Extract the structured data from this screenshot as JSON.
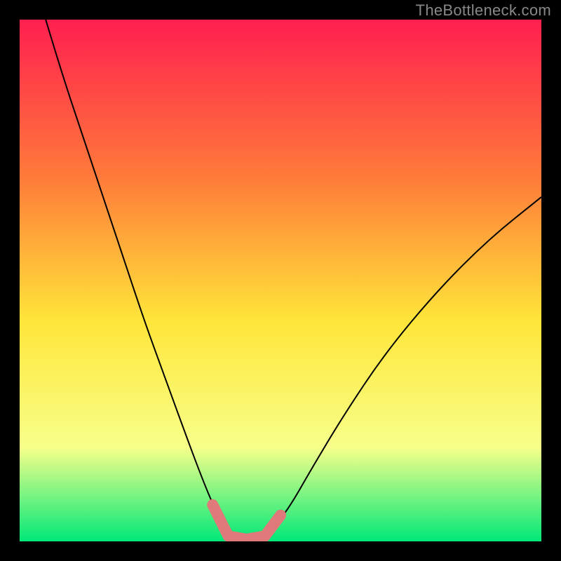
{
  "watermark": "TheBottleneck.com",
  "colors": {
    "gradient_top": "#ff1f4f",
    "gradient_mid_upper": "#ff7a3a",
    "gradient_mid": "#ffe63a",
    "gradient_lower": "#f7ff8a",
    "gradient_bottom": "#00e878",
    "curve": "#000000",
    "highlight": "#e07a7a",
    "frame": "#000000"
  },
  "chart_data": {
    "type": "line",
    "title": "",
    "xlabel": "",
    "ylabel": "",
    "xlim": [
      0,
      100
    ],
    "ylim": [
      0,
      100
    ],
    "series": [
      {
        "name": "left-curve",
        "x": [
          5,
          8,
          12,
          16,
          20,
          24,
          28,
          32,
          35,
          37.5,
          39,
          40
        ],
        "y": [
          100,
          90,
          78,
          66,
          54,
          42,
          31,
          20,
          12,
          6,
          3,
          1
        ]
      },
      {
        "name": "right-curve",
        "x": [
          47,
          49,
          52,
          56,
          62,
          70,
          80,
          90,
          100
        ],
        "y": [
          1,
          3,
          7,
          14,
          24,
          36,
          48,
          58,
          66
        ]
      },
      {
        "name": "valley-floor",
        "x": [
          40,
          43.5,
          47
        ],
        "y": [
          1,
          0.4,
          1
        ]
      }
    ],
    "highlight_segments": [
      {
        "name": "left-tip",
        "x": [
          37,
          40
        ],
        "y": [
          7,
          1
        ]
      },
      {
        "name": "floor",
        "x": [
          40,
          43.5,
          47
        ],
        "y": [
          1,
          0.4,
          1
        ]
      },
      {
        "name": "right-tip",
        "x": [
          47,
          50
        ],
        "y": [
          1,
          5
        ]
      }
    ]
  }
}
